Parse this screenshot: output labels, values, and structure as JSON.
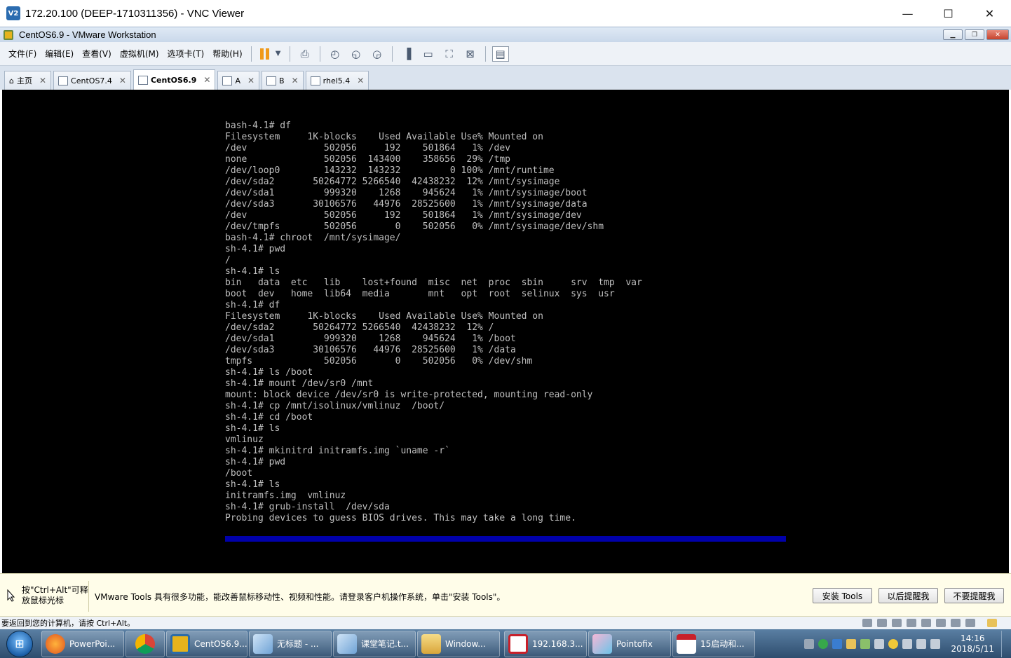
{
  "vnc": {
    "logo": "V2",
    "title": "172.20.100 (DEEP-1710311356) - VNC Viewer",
    "minimize": "—",
    "maximize": "☐",
    "close": "✕"
  },
  "vmware": {
    "title": "CentOS6.9 - VMware Workstation",
    "menu": [
      "文件(F)",
      "编辑(E)",
      "查看(V)",
      "虚拟机(M)",
      "选项卡(T)",
      "帮助(H)"
    ]
  },
  "tabs": [
    {
      "label": "主页"
    },
    {
      "label": "CentOS7.4"
    },
    {
      "label": "CentOS6.9",
      "active": true
    },
    {
      "label": "A"
    },
    {
      "label": "B"
    },
    {
      "label": "rhel5.4"
    }
  ],
  "console": {
    "lines": [
      "bash-4.1# df",
      "Filesystem     1K-blocks    Used Available Use% Mounted on",
      "/dev              502056     192    501864   1% /dev",
      "none              502056  143400    358656  29% /tmp",
      "/dev/loop0        143232  143232         0 100% /mnt/runtime",
      "/dev/sda2       50264772 5266540  42438232  12% /mnt/sysimage",
      "/dev/sda1         999320    1268    945624   1% /mnt/sysimage/boot",
      "/dev/sda3       30106576   44976  28525600   1% /mnt/sysimage/data",
      "/dev              502056     192    501864   1% /mnt/sysimage/dev",
      "/dev/tmpfs        502056       0    502056   0% /mnt/sysimage/dev/shm",
      "bash-4.1# chroot  /mnt/sysimage/",
      "sh-4.1# pwd",
      "/",
      "sh-4.1# ls",
      "bin   data  etc   lib    lost+found  misc  net  proc  sbin     srv  tmp  var",
      "boot  dev   home  lib64  media       mnt   opt  root  selinux  sys  usr",
      "sh-4.1# df",
      "Filesystem     1K-blocks    Used Available Use% Mounted on",
      "/dev/sda2       50264772 5266540  42438232  12% /",
      "/dev/sda1         999320    1268    945624   1% /boot",
      "/dev/sda3       30106576   44976  28525600   1% /data",
      "tmpfs             502056       0    502056   0% /dev/shm",
      "sh-4.1# ls /boot",
      "sh-4.1# mount /dev/sr0 /mnt",
      "mount: block device /dev/sr0 is write-protected, mounting read-only",
      "sh-4.1# cp /mnt/isolinux/vmlinuz  /boot/",
      "sh-4.1# cd /boot",
      "sh-4.1# ls",
      "vmlinuz",
      "sh-4.1# mkinitrd initramfs.img `uname -r`",
      "sh-4.1# pwd",
      "/boot",
      "sh-4.1# ls",
      "initramfs.img  vmlinuz",
      "sh-4.1# grub-install  /dev/sda",
      "Probing devices to guess BIOS drives. This may take a long time."
    ],
    "progress_color": "#0000aa"
  },
  "hint": {
    "release": "按\"Ctrl+Alt\"可释\n放鼠标光标",
    "message": "VMware Tools 具有很多功能，能改善鼠标移动性、视频和性能。请登录客户机操作系统，单击\"安装 Tools\"。",
    "buttons": [
      "安装 Tools",
      "以后提醒我",
      "不要提醒我"
    ]
  },
  "status_text": "要返回到您的计算机，请按 Ctrl+Alt。",
  "taskbar": {
    "items": [
      {
        "label": "PowerPoi...",
        "color": "#e06b1f"
      },
      {
        "label": "",
        "color": "#d33b2c"
      },
      {
        "label": "CentOS6.9...",
        "color": "#e6b31c"
      },
      {
        "label": "无标题 - ...",
        "color": "#6fa3d6"
      },
      {
        "label": "课堂笔记.t...",
        "color": "#6fa3d6"
      },
      {
        "label": "Window...",
        "color": "#e8c25a"
      },
      {
        "label": "192.168.3...",
        "color": "#c8202a"
      },
      {
        "label": "Pointofix",
        "color": "#d35fa3"
      },
      {
        "label": "15启动和...",
        "color": "#c8202a"
      }
    ],
    "clock_time": "14:16",
    "clock_date": "2018/5/11"
  }
}
